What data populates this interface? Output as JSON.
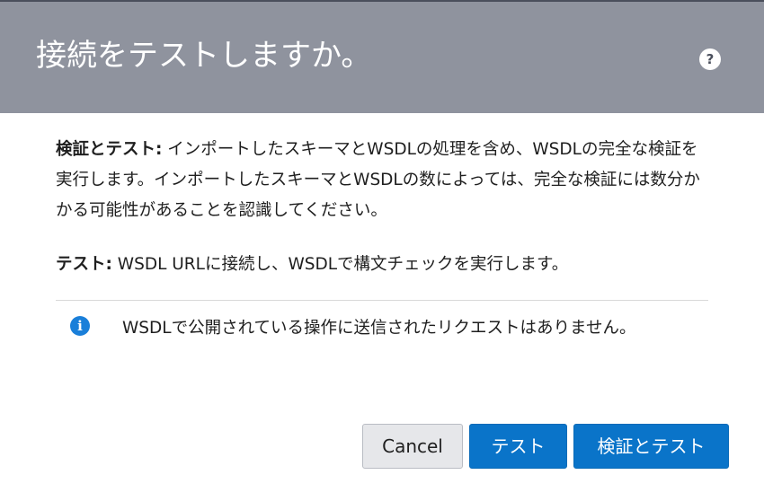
{
  "dialog": {
    "title": "接続をテストしますか。",
    "help_label": "?"
  },
  "content": {
    "para1_label": "検証とテスト:",
    "para1_text": " インポートしたスキーマとWSDLの処理を含め、WSDLの完全な検証を実行します。インポートしたスキーマとWSDLの数によっては、完全な検証には数分かかる可能性があることを認識してください。",
    "para2_label": "テスト:",
    "para2_text": " WSDL URLに接続し、WSDLで構文チェックを実行します。",
    "info_icon_glyph": "i",
    "info_text": "WSDLで公開されている操作に送信されたリクエストはありません。"
  },
  "buttons": {
    "cancel": "Cancel",
    "test": "テスト",
    "validate_and_test": "検証とテスト"
  },
  "colors": {
    "header_bg": "#8f939e",
    "primary_button": "#0a74c9",
    "info_icon": "#1a7fd9"
  },
  "icons": {
    "help": "help-icon",
    "info": "info-icon"
  }
}
